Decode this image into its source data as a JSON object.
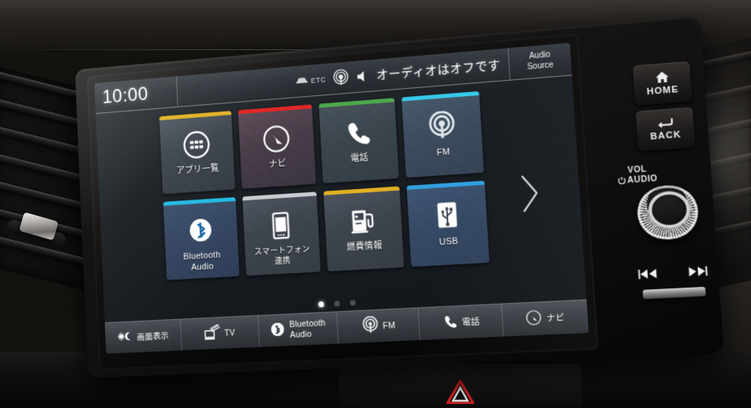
{
  "device": {
    "name": "car-infotainment-head-unit",
    "screen_label": "Honda head unit display"
  },
  "status_bar": {
    "clock": "10:00",
    "etc_label": "ETC",
    "etc_icon": "car-icon",
    "fm_icon": "fm-broadcast-icon",
    "mute_icon": "speaker-mute-icon",
    "message": "オーディオはオフです",
    "audio_source_line1": "Audio",
    "audio_source_line2": "Source"
  },
  "app_grid": {
    "next_page_icon": "chevron-right-icon",
    "page_count": 3,
    "active_page": 1,
    "tiles": [
      {
        "id": "apps",
        "label_line1": "アプリ一覧",
        "label_line2": "",
        "icon": "app-grid-icon",
        "accent": "#e0b020"
      },
      {
        "id": "navi",
        "label_line1": "ナビ",
        "label_line2": "",
        "icon": "compass-arrow-icon",
        "accent": "#e02424"
      },
      {
        "id": "phone",
        "label_line1": "電話",
        "label_line2": "",
        "icon": "phone-handset-icon",
        "accent": "#4aa84a"
      },
      {
        "id": "fm",
        "label_line1": "FM",
        "label_line2": "",
        "icon": "fm-broadcast-icon",
        "accent": "#35c8e8"
      },
      {
        "id": "bt-audio",
        "label_line1": "Bluetooth",
        "label_line2": "Audio",
        "icon": "bluetooth-icon",
        "accent": "#22b8e0"
      },
      {
        "id": "smartphone",
        "label_line1": "スマートフォン",
        "label_line2": "連携",
        "icon": "smartphone-icon",
        "accent": "#c9ccd0"
      },
      {
        "id": "fuel",
        "label_line1": "燃費情報",
        "label_line2": "",
        "icon": "fuel-pump-icon",
        "accent": "#e0b020"
      },
      {
        "id": "usb",
        "label_line1": "USB",
        "label_line2": "",
        "icon": "usb-icon",
        "accent": "#2f9fe0"
      }
    ]
  },
  "taskbar": {
    "items": [
      {
        "id": "display",
        "label_line1": "画面表示",
        "label_line2": "",
        "icon": "brightness-day-night-icon"
      },
      {
        "id": "tv",
        "label_line1": "TV",
        "label_line2": "",
        "icon": "tv-antenna-icon"
      },
      {
        "id": "bt-audio",
        "label_line1": "Bluetooth",
        "label_line2": "Audio",
        "icon": "bluetooth-icon"
      },
      {
        "id": "fm",
        "label_line1": "FM",
        "label_line2": "",
        "icon": "fm-broadcast-icon"
      },
      {
        "id": "phone",
        "label_line1": "電話",
        "label_line2": "",
        "icon": "phone-handset-icon"
      },
      {
        "id": "navi",
        "label_line1": "ナビ",
        "label_line2": "",
        "icon": "compass-arrow-icon"
      }
    ]
  },
  "hard_keys": {
    "home_label": "HOME",
    "home_icon": "house-icon",
    "back_label": "BACK",
    "back_icon": "back-arrow-icon",
    "volume_label_line1": "VOL",
    "volume_label_line2": "AUDIO",
    "power_icon": "power-icon",
    "skip_prev_icon": "skip-previous-icon",
    "skip_next_icon": "skip-next-icon"
  },
  "dashboard": {
    "hazard_icon": "hazard-triangle-icon",
    "hazard_color": "#d42020",
    "vent_left_icon": "air-vent-icon",
    "vent_right_icon": "air-vent-icon"
  },
  "colors": {
    "screen_bg": "#1b2025",
    "statusbar_bg": "#2d3238",
    "taskbar_bg": "#3a3f45",
    "tile_bg": "#3c434c",
    "text": "#ffffff",
    "active_dot": "#ffffff"
  }
}
